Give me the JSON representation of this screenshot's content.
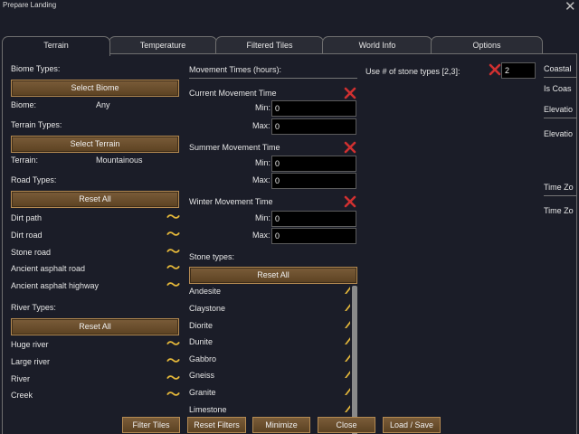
{
  "window": {
    "title": "Prepare Landing",
    "close_glyph": "✕"
  },
  "tabs": [
    "Terrain",
    "Temperature",
    "Filtered Tiles",
    "World Info",
    "Options"
  ],
  "biome": {
    "label": "Biome Types:",
    "button": "Select Biome",
    "key": "Biome:",
    "value": "Any"
  },
  "terrain": {
    "label": "Terrain Types:",
    "button": "Select Terrain",
    "key": "Terrain:",
    "value": "Mountainous"
  },
  "roads": {
    "label": "Road Types:",
    "reset": "Reset All",
    "items": [
      "Dirt path",
      "Dirt road",
      "Stone road",
      "Ancient asphalt road",
      "Ancient asphalt highway"
    ]
  },
  "rivers": {
    "label": "River Types:",
    "reset": "Reset All",
    "items": [
      "Huge river",
      "Large river",
      "River",
      "Creek"
    ]
  },
  "movement": {
    "label": "Movement Times (hours):",
    "groups": [
      {
        "title": "Current Movement Time",
        "min_label": "Min:",
        "min": "0",
        "max_label": "Max:",
        "max": "0"
      },
      {
        "title": "Summer Movement Time",
        "min_label": "Min:",
        "min": "0",
        "max_label": "Max:",
        "max": "0"
      },
      {
        "title": "Winter Movement Time",
        "min_label": "Min:",
        "min": "0",
        "max_label": "Max:",
        "max": "0"
      }
    ]
  },
  "stones": {
    "label": "Stone types:",
    "reset": "Reset All",
    "items": [
      "Andesite",
      "Claystone",
      "Diorite",
      "Dunite",
      "Gabbro",
      "Gneiss",
      "Granite",
      "Limestone"
    ],
    "use_count_label": "Use # of stone types [2,3]:",
    "use_count_value": "2"
  },
  "right_column": [
    "Coastal",
    "Is Coas",
    "Elevatio",
    "Elevatio",
    "Time Zo",
    "Time Zo"
  ],
  "bottom_buttons": [
    "Filter Tiles",
    "Reset Filters",
    "Minimize",
    "Close",
    "Load / Save"
  ],
  "icons": {
    "wave": "〜",
    "wave_name": "road-river-wave-icon"
  },
  "colors": {
    "button_brown": "#6b4e2e",
    "accent_gold": "#e5b83a",
    "remove_red": "#d03030",
    "background": "#1b1d28"
  }
}
